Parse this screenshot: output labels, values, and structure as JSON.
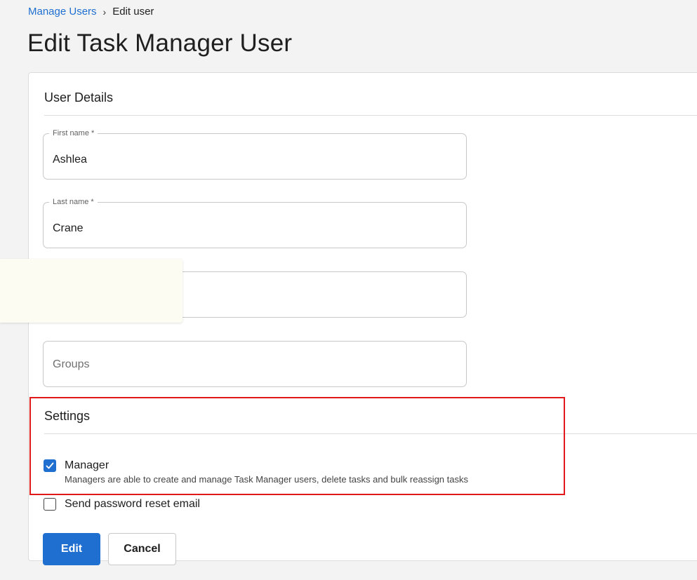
{
  "breadcrumb": {
    "parent": "Manage Users",
    "separator": "›",
    "current": "Edit user"
  },
  "page": {
    "title": "Edit Task Manager User"
  },
  "user_details": {
    "heading": "User Details",
    "first_name": {
      "label": "First name *",
      "value": "Ashlea"
    },
    "last_name": {
      "label": "Last name *",
      "value": "Crane"
    },
    "groups": {
      "placeholder": "Groups"
    }
  },
  "settings": {
    "heading": "Settings",
    "manager": {
      "label": "Manager",
      "description": "Managers are able to create and manage Task Manager users, delete tasks and bulk reassign tasks",
      "checked": true
    },
    "reset_email": {
      "label": "Send password reset email",
      "checked": false
    }
  },
  "actions": {
    "edit_label": "Edit",
    "cancel_label": "Cancel"
  },
  "colors": {
    "accent": "#1f6fd0",
    "highlight": "#e01a1a",
    "tooltip_bg": "#fdfcf3"
  },
  "icons": {
    "checkmark": "check-icon"
  }
}
